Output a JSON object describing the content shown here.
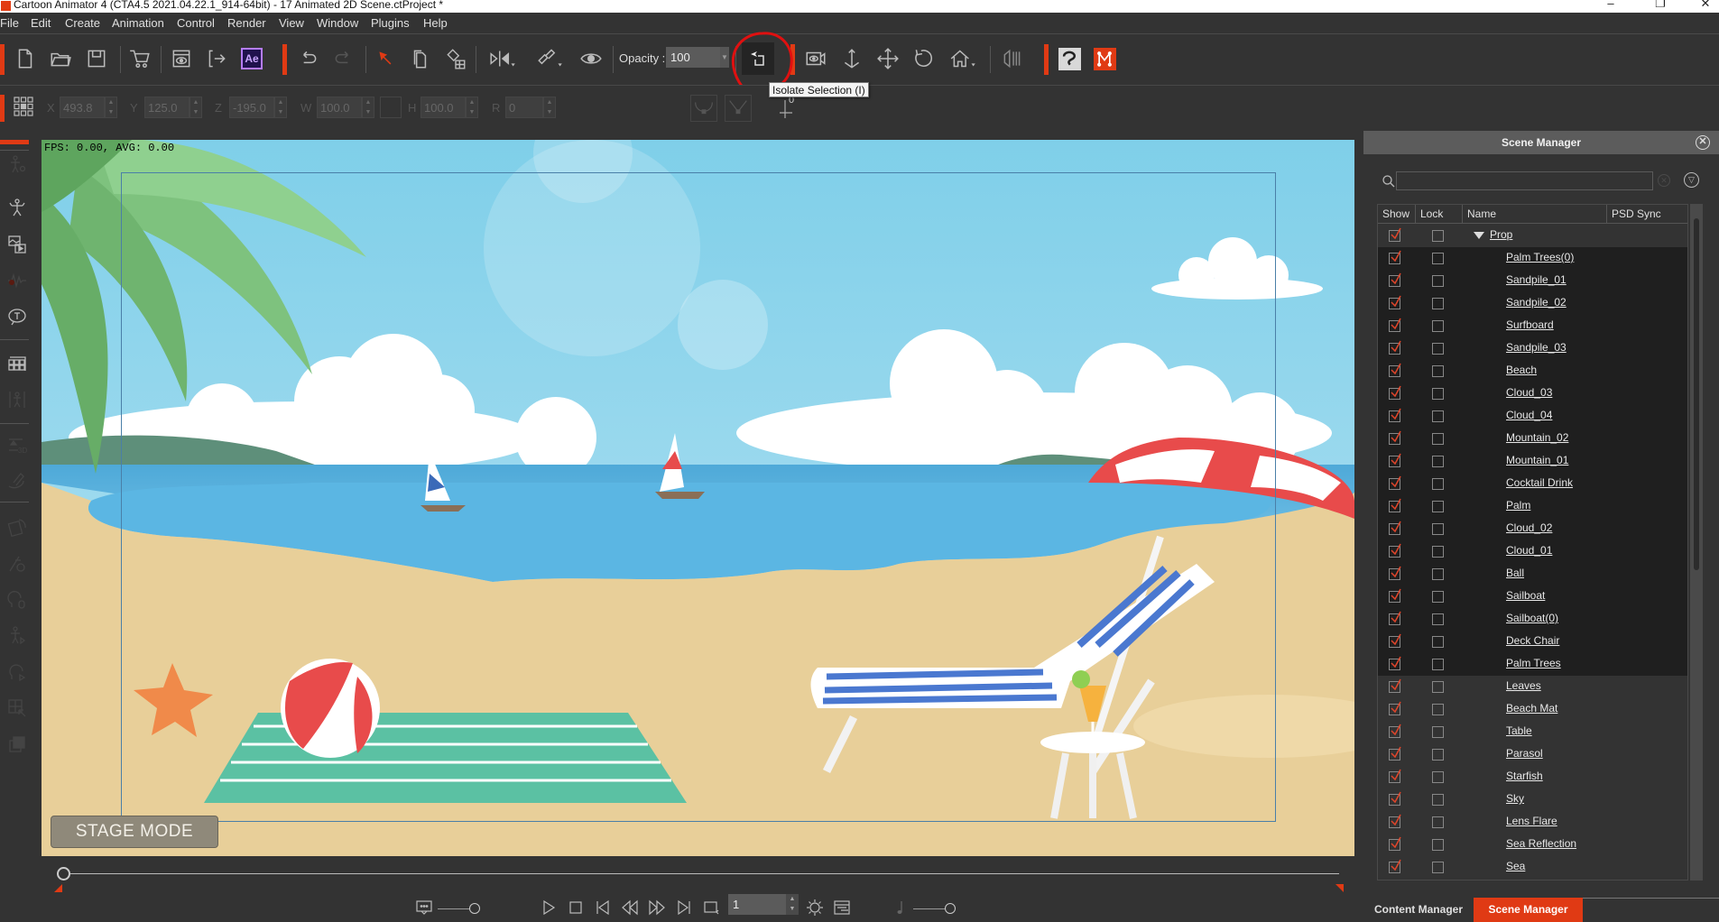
{
  "window": {
    "title": "Cartoon Animator 4  (CTA4.5 2021.04.22.1_914-64bit) - 17 Animated 2D Scene.ctProject *",
    "buttons": [
      "minimize",
      "maximize",
      "close"
    ]
  },
  "menu": [
    "File",
    "Edit",
    "Create",
    "Animation",
    "Control",
    "Render",
    "View",
    "Window",
    "Plugins",
    "Help"
  ],
  "toolbar": {
    "icons": [
      "new-file-icon",
      "open-folder-icon",
      "save-icon",
      "cart-icon",
      "preview-icon",
      "export-icon",
      "after-effects-icon",
      "undo-icon",
      "redo-icon",
      "select-arrow-icon",
      "duplicate-icon",
      "paint-bucket-icon",
      "flip-icon",
      "link-icon",
      "eye-icon",
      "isolate-selection-icon",
      "camera-view-icon",
      "move-down-icon",
      "move-icon",
      "rotate-icon",
      "home-icon",
      "audio-icon",
      "clip-studio-icon",
      "motion-icon"
    ],
    "ae_label": "Ae",
    "opacity_label": "Opacity :",
    "opacity_value": "100",
    "tooltip": "Isolate Selection (I)",
    "accent": "#e03a14"
  },
  "transform": {
    "x_label": "X",
    "x_value": "493.8",
    "y_label": "Y",
    "y_value": "125.0",
    "z_label": "Z",
    "z_value": "-195.0",
    "w_label": "W",
    "w_value": "100.0",
    "h_label": "H",
    "h_value": "100.0",
    "r_label": "R",
    "r_value": "0",
    "pivot_value": "0"
  },
  "viewport": {
    "fps_text": "FPS: 0.00, AVG: 0.00",
    "stage_mode_label": "STAGE MODE"
  },
  "playback": {
    "frame_value": "1"
  },
  "scene_manager": {
    "title": "Scene Manager",
    "search_placeholder": "",
    "columns": [
      "Show",
      "Lock",
      "Name",
      "PSD Sync"
    ],
    "root": {
      "name": "Prop",
      "show": true,
      "lock": false
    },
    "items": [
      {
        "name": "Palm Trees(0)",
        "show": true,
        "lock": false,
        "selected": true
      },
      {
        "name": "Sandpile_01",
        "show": true,
        "lock": false,
        "selected": true
      },
      {
        "name": "Sandpile_02",
        "show": true,
        "lock": false,
        "selected": true
      },
      {
        "name": "Surfboard",
        "show": true,
        "lock": false,
        "selected": true
      },
      {
        "name": "Sandpile_03",
        "show": true,
        "lock": false,
        "selected": true
      },
      {
        "name": "Beach",
        "show": true,
        "lock": false,
        "selected": true
      },
      {
        "name": "Cloud_03",
        "show": true,
        "lock": false,
        "selected": true
      },
      {
        "name": "Cloud_04",
        "show": true,
        "lock": false,
        "selected": true
      },
      {
        "name": "Mountain_02",
        "show": true,
        "lock": false,
        "selected": true
      },
      {
        "name": "Mountain_01",
        "show": true,
        "lock": false,
        "selected": true
      },
      {
        "name": "Cocktail Drink",
        "show": true,
        "lock": false,
        "selected": true
      },
      {
        "name": "Palm",
        "show": true,
        "lock": false,
        "selected": true
      },
      {
        "name": "Cloud_02",
        "show": true,
        "lock": false,
        "selected": true
      },
      {
        "name": "Cloud_01",
        "show": true,
        "lock": false,
        "selected": true
      },
      {
        "name": "Ball",
        "show": true,
        "lock": false,
        "selected": true
      },
      {
        "name": "Sailboat",
        "show": true,
        "lock": false,
        "selected": true
      },
      {
        "name": "Sailboat(0)",
        "show": true,
        "lock": false,
        "selected": true
      },
      {
        "name": "Deck Chair",
        "show": true,
        "lock": false,
        "selected": true
      },
      {
        "name": "Palm Trees",
        "show": true,
        "lock": false,
        "selected": true
      },
      {
        "name": "Leaves",
        "show": true,
        "lock": false,
        "selected": false
      },
      {
        "name": "Beach Mat",
        "show": true,
        "lock": false,
        "selected": false
      },
      {
        "name": "Table",
        "show": true,
        "lock": false,
        "selected": false
      },
      {
        "name": "Parasol",
        "show": true,
        "lock": false,
        "selected": false
      },
      {
        "name": "Starfish",
        "show": true,
        "lock": false,
        "selected": false
      },
      {
        "name": "Sky",
        "show": true,
        "lock": false,
        "selected": false
      },
      {
        "name": "Lens Flare",
        "show": true,
        "lock": false,
        "selected": false
      },
      {
        "name": "Sea Reflection",
        "show": true,
        "lock": false,
        "selected": false
      },
      {
        "name": "Sea",
        "show": true,
        "lock": false,
        "selected": false
      }
    ],
    "tabs": [
      {
        "label": "Content Manager",
        "active": false
      },
      {
        "label": "Scene Manager",
        "active": true
      }
    ]
  }
}
